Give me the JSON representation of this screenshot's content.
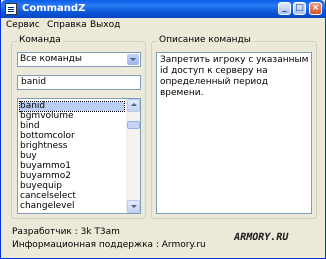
{
  "window": {
    "title": "CommandZ"
  },
  "menu": [
    {
      "label": "Сервис"
    },
    {
      "label": "Справка"
    },
    {
      "label": "Выход"
    }
  ],
  "left_panel": {
    "legend": "Команда",
    "category_select": "Все команды",
    "search_value": "banid",
    "commands": [
      "banid",
      "bgmvolume",
      "bind",
      "bottomcolor",
      "brightness",
      "buy",
      "buyammo1",
      "buyammo2",
      "buyequip",
      "cancelselect",
      "changelevel"
    ],
    "selected_command": "banid"
  },
  "right_panel": {
    "legend": "Описание команды",
    "description": "Запретить игроку с указанным id доступ к серверу на определенный период времени."
  },
  "footer": {
    "developer": "Разработчик : 3k T3am",
    "support": "Информационная поддержка : Armory.ru"
  },
  "logo": "ARMORY.RU",
  "colors": {
    "titlebar": "#0a5ce8",
    "window": "#ece9d8",
    "selection": "#b9cff5"
  }
}
